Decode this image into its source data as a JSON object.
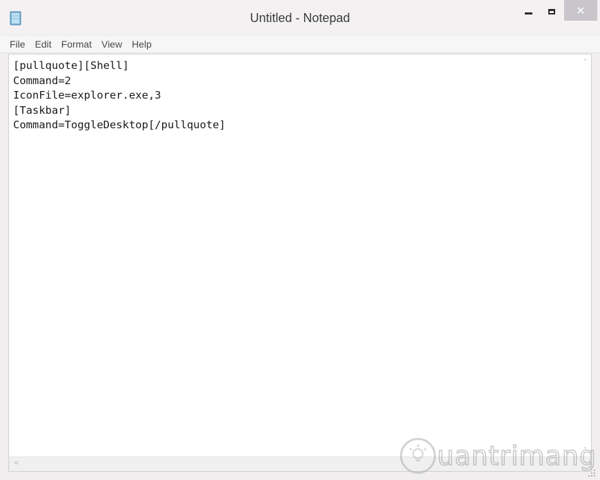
{
  "window": {
    "title": "Untitled - Notepad",
    "close_symbol": "✕",
    "app_icon": "notepad-icon"
  },
  "menu": {
    "items": [
      "File",
      "Edit",
      "Format",
      "View",
      "Help"
    ]
  },
  "editor": {
    "content": "[pullquote][Shell]\nCommand=2\nIconFile=explorer.exe,3\n[Taskbar]\nCommand=ToggleDesktop[/pullquote]"
  },
  "scrollbars": {
    "up_arrow": "˄",
    "down_arrow": "˅",
    "left_arrow": "<"
  },
  "watermark": {
    "text": "uantrimang"
  }
}
